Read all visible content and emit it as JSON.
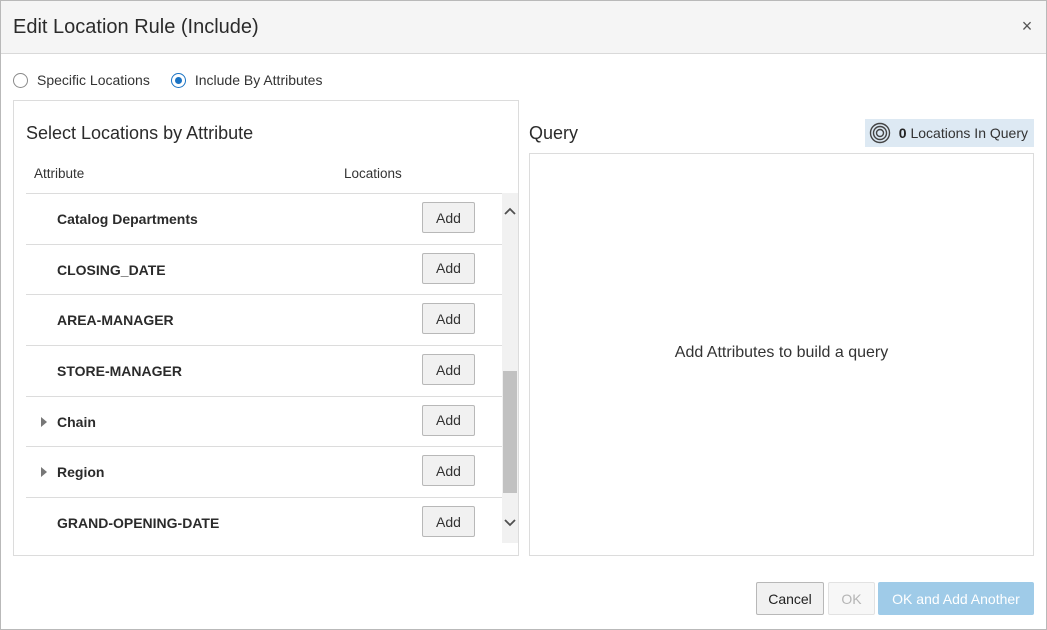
{
  "dialog": {
    "title": "Edit Location Rule (Include)",
    "close_symbol": "×"
  },
  "mode": {
    "options": [
      {
        "label": "Specific Locations",
        "selected": false
      },
      {
        "label": "Include By Attributes",
        "selected": true
      }
    ]
  },
  "attributes_panel": {
    "title": "Select Locations by Attribute",
    "columns": {
      "attribute": "Attribute",
      "locations": "Locations"
    },
    "rows": [
      {
        "name": "Catalog Departments",
        "expandable": false,
        "action": "Add"
      },
      {
        "name": "CLOSING_DATE",
        "expandable": false,
        "action": "Add"
      },
      {
        "name": "AREA-MANAGER",
        "expandable": false,
        "action": "Add"
      },
      {
        "name": "STORE-MANAGER",
        "expandable": false,
        "action": "Add"
      },
      {
        "name": "Chain",
        "expandable": true,
        "action": "Add"
      },
      {
        "name": "Region",
        "expandable": true,
        "action": "Add"
      },
      {
        "name": "GRAND-OPENING-DATE",
        "expandable": false,
        "action": "Add"
      }
    ],
    "scroll": {
      "up_icon": "chevron-up-icon",
      "down_icon": "chevron-down-icon"
    }
  },
  "query_panel": {
    "title": "Query",
    "count": "0",
    "count_label": "Locations In Query",
    "count_icon": "target-icon",
    "empty_message": "Add Attributes to build a query"
  },
  "footer": {
    "cancel": "Cancel",
    "ok": "OK",
    "ok_and_add": "OK and Add Another"
  },
  "colors": {
    "accent": "#1a73c4",
    "primary_disabled": "#9fcbe8",
    "badge_bg": "#dde9f3"
  }
}
